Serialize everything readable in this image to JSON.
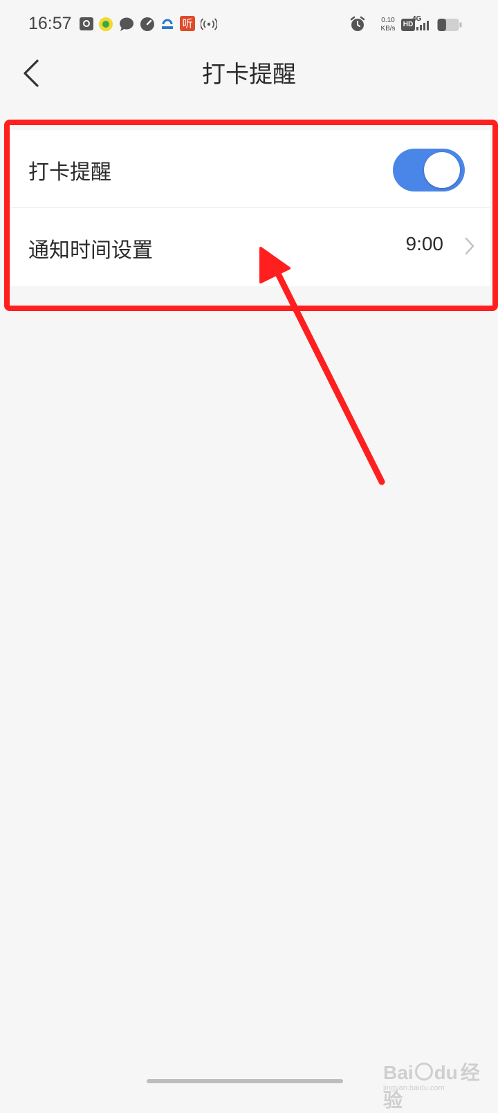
{
  "status_bar": {
    "time": "16:57",
    "network_speed": "0.10",
    "network_unit": "KB/s",
    "hd": "HD",
    "signal": "4G",
    "left_icons": [
      "screenshot-icon",
      "qq-music-icon",
      "message-icon",
      "speedometer-icon",
      "app-icon",
      "ting-icon",
      "hotspot-icon"
    ],
    "right_icons": [
      "alarm-icon",
      "hd-icon",
      "signal-icon",
      "battery-icon"
    ],
    "ting_glyph": "听",
    "battery_level": 0.4
  },
  "nav": {
    "back_icon": "chevron-left-icon",
    "title": "打卡提醒"
  },
  "settings": {
    "reminder_label": "打卡提醒",
    "reminder_enabled": true,
    "notify_label": "通知时间设置",
    "notify_value": "9:00"
  },
  "annotation": {
    "box_color": "#ff1f1f",
    "arrow_color": "#ff1f1f"
  },
  "colors": {
    "accent": "#4a86e8",
    "background": "#f6f6f6"
  },
  "watermark": {
    "text": "Bai",
    "text2": "du",
    "text3": "经验",
    "sub": "jingyan.baidu.com"
  }
}
